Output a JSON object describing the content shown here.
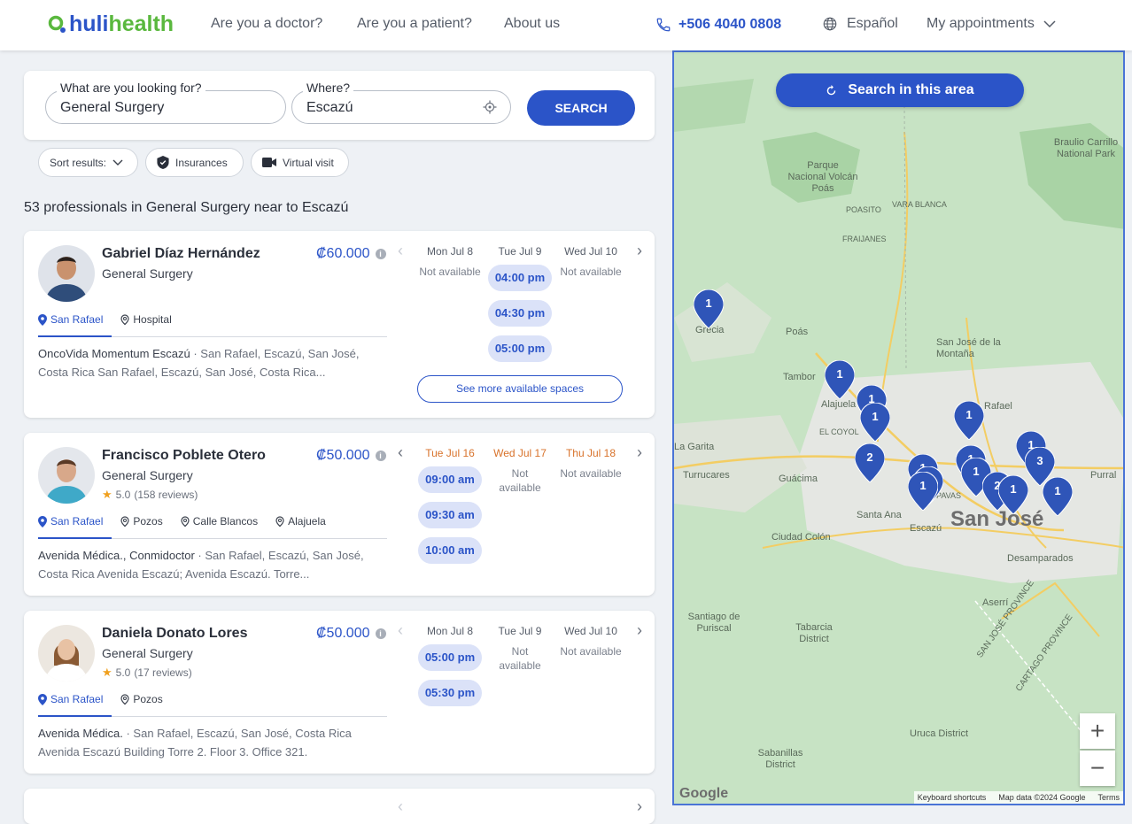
{
  "header": {
    "logo_prefix": "huli",
    "logo_suffix": "health",
    "nav": [
      "Are you a doctor?",
      "Are you a patient?",
      "About us"
    ],
    "phone": "+506 4040 0808",
    "language": "Español",
    "appointments": "My appointments"
  },
  "search": {
    "what_label": "What are you looking for?",
    "what_value": "General Surgery",
    "where_label": "Where?",
    "where_value": "Escazú",
    "button": "SEARCH"
  },
  "filters": {
    "sort": "Sort results:",
    "insurances": "Insurances",
    "virtual": "Virtual visit"
  },
  "results_count": "53 professionals in General Surgery near to Escazú",
  "doctors": [
    {
      "name": "Gabriel Díaz Hernández",
      "specialty": "General Surgery",
      "price": "₡60.000",
      "tabs": [
        "San Rafael",
        "Hospital"
      ],
      "address_main": "OncoVida Momentum Escazú",
      "address_rest": " · San Rafael, Escazú, San José, Costa Rica San Rafael, Escazú, San José, Costa Rica...",
      "days": [
        {
          "label": "Mon Jul 8",
          "na": "Not available",
          "slots": []
        },
        {
          "label": "Tue Jul 9",
          "na": "",
          "slots": [
            "04:00 pm",
            "04:30 pm",
            "05:00 pm"
          ]
        },
        {
          "label": "Wed Jul 10",
          "na": "Not available",
          "slots": []
        }
      ],
      "more": "See more available spaces"
    },
    {
      "name": "Francisco Poblete Otero",
      "specialty": "General Surgery",
      "rating": "5.0",
      "reviews": "(158 reviews)",
      "price": "₡50.000",
      "tabs": [
        "San Rafael",
        "Pozos",
        "Calle Blancos",
        "Alajuela"
      ],
      "address_main": "Avenida Médica., Conmidoctor",
      "address_rest": " · San Rafael, Escazú, San José, Costa Rica Avenida Escazú; Avenida Escazú. Torre...",
      "days": [
        {
          "label": "Tue Jul 16",
          "na": "",
          "slots": [
            "09:00 am",
            "09:30 am",
            "10:00 am"
          ]
        },
        {
          "label": "Wed Jul 17",
          "na": "Not available",
          "slots": []
        },
        {
          "label": "Thu Jul 18",
          "na": "Not available",
          "slots": []
        }
      ]
    },
    {
      "name": "Daniela Donato Lores",
      "specialty": "General Surgery",
      "rating": "5.0",
      "reviews": "(17 reviews)",
      "price": "₡50.000",
      "tabs": [
        "San Rafael",
        "Pozos"
      ],
      "address_main": "Avenida Médica.",
      "address_rest": " · San Rafael, Escazú, San José, Costa Rica Avenida Escazú Building Torre 2. Floor 3. Office 321.",
      "days": [
        {
          "label": "Mon Jul 8",
          "na": "",
          "slots": [
            "05:00 pm",
            "05:30 pm"
          ]
        },
        {
          "label": "Tue Jul 9",
          "na": "Not available",
          "slots": []
        },
        {
          "label": "Wed Jul 10",
          "na": "Not available",
          "slots": []
        }
      ]
    }
  ],
  "map": {
    "button": "Search in this area",
    "labels": [
      "Grecia",
      "Poás",
      "Tambor",
      "Alajuela",
      "San José de la Montaña",
      "Rafael",
      "EL COYOL",
      "Guácima",
      "Santa Ana",
      "Escazú",
      "Ciudad Colón",
      "Desamparados",
      "Aserrí",
      "Tabarcia District",
      "Santiago de Puriscal",
      "Uruca District",
      "Sabanillas District",
      "Parque Nacional Volcán Poás",
      "Braulio Carrillo National Park",
      "POASITO",
      "VARA BLANCA",
      "FRAIJANES",
      "La Garita",
      "Turrucares",
      "Purral",
      "SAN JOSÉ PROVINCE",
      "CARTAGO PROVINCE",
      "PAVAS"
    ],
    "city": "San José",
    "pins": [
      "1",
      "1",
      "1",
      "1",
      "1",
      "2",
      "1",
      "1",
      "1",
      "1",
      "2",
      "1",
      "1",
      "1",
      "3",
      "1"
    ],
    "zoom_in": "+",
    "zoom_out": "−",
    "google": "Google",
    "attribution": [
      "Keyboard shortcuts",
      "Map data ©2024 Google",
      "Terms"
    ]
  }
}
